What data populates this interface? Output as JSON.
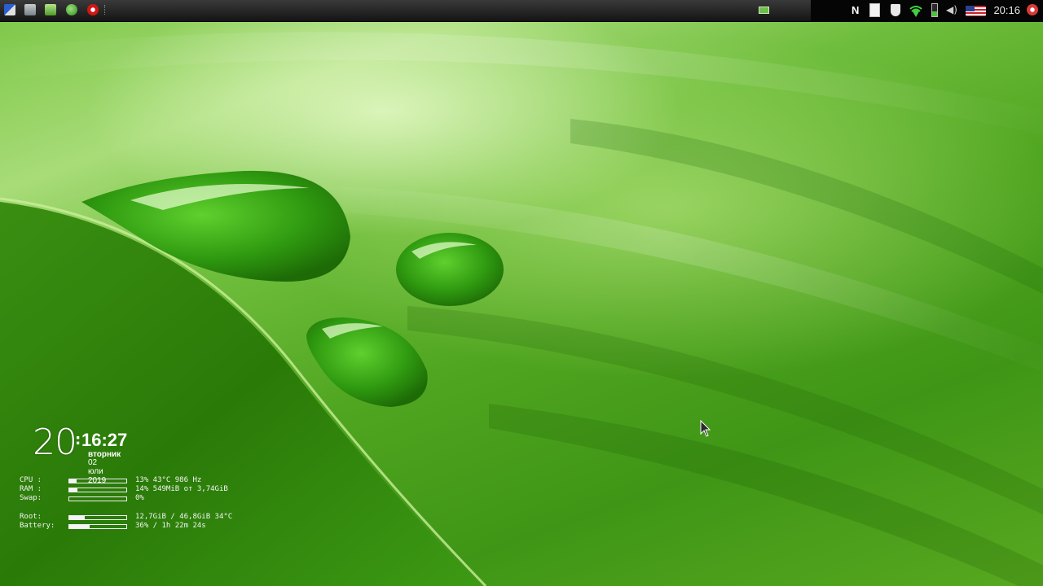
{
  "taskbar": {
    "launchers": [
      {
        "icon": "app-menu-icon",
        "color": "#3a6fd8"
      },
      {
        "icon": "file-manager-icon",
        "color": "#9aa0a8"
      },
      {
        "icon": "text-editor-icon",
        "color": "#6cc04a"
      },
      {
        "icon": "browser-icon",
        "color": "#3fa23a"
      },
      {
        "icon": "opera-icon",
        "color": "#d01818"
      }
    ],
    "tray": {
      "clock": "20:16",
      "icons": [
        "notes-icon",
        "clipboard-icon",
        "shield-icon",
        "wifi-icon",
        "battery-icon",
        "volume-icon",
        "us-flag-icon",
        "power-icon"
      ]
    }
  },
  "conky": {
    "hour": "20",
    "colon": ":",
    "min_sec": "16:27",
    "weekday": "вторник",
    "date": "02 юли 2019",
    "stats": [
      {
        "label": "CPU :",
        "fill": 0.13,
        "value": "13%  43°C 986 Hz"
      },
      {
        "label": "RAM :",
        "fill": 0.14,
        "value": "14% 549MiB от 3,74GiB"
      },
      {
        "label": "Swap:",
        "fill": 0.0,
        "value": "0%"
      },
      {
        "label": "Root:",
        "fill": 0.27,
        "value": "12,7GiB / 46,8GiB 34°C"
      },
      {
        "label": "Battery:",
        "fill": 0.36,
        "value": "36% / 1h 22m 24s"
      }
    ]
  }
}
